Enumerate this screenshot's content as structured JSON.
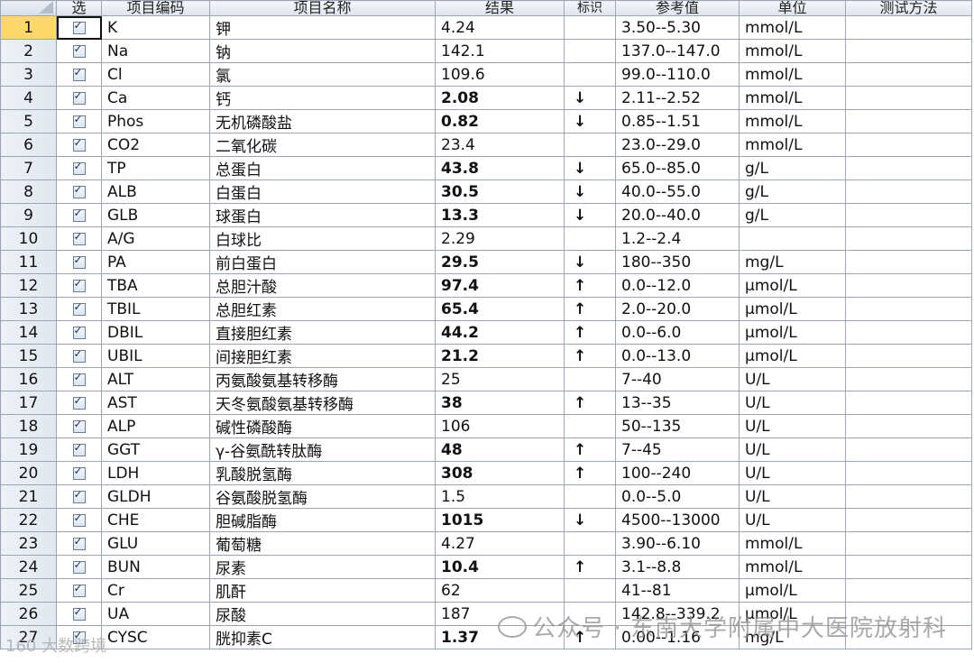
{
  "columns": {
    "select": "选",
    "code": "项目编码",
    "name": "项目名称",
    "result": "结果",
    "flag": "标识",
    "ref": "参考值",
    "unit": "单位",
    "method": "测试方法"
  },
  "selected_row": 1,
  "rows": [
    {
      "n": "1",
      "code": "K",
      "name": "钾",
      "result": "4.24",
      "flag": "",
      "dir": "",
      "ref": "3.50--5.30",
      "unit": "mmol/L",
      "method": ""
    },
    {
      "n": "2",
      "code": "Na",
      "name": "钠",
      "result": "142.1",
      "flag": "",
      "dir": "",
      "ref": "137.0--147.0",
      "unit": "mmol/L",
      "method": ""
    },
    {
      "n": "3",
      "code": "Cl",
      "name": "氯",
      "result": "109.6",
      "flag": "",
      "dir": "",
      "ref": "99.0--110.0",
      "unit": "mmol/L",
      "method": ""
    },
    {
      "n": "4",
      "code": "Ca",
      "name": "钙",
      "result": "2.08",
      "flag": "↓",
      "dir": "low",
      "ref": "2.11--2.52",
      "unit": "mmol/L",
      "method": ""
    },
    {
      "n": "5",
      "code": "Phos",
      "name": "无机磷酸盐",
      "result": "0.82",
      "flag": "↓",
      "dir": "low",
      "ref": "0.85--1.51",
      "unit": "mmol/L",
      "method": ""
    },
    {
      "n": "6",
      "code": "CO2",
      "name": "二氧化碳",
      "result": "23.4",
      "flag": "",
      "dir": "",
      "ref": "23.0--29.0",
      "unit": "mmol/L",
      "method": ""
    },
    {
      "n": "7",
      "code": "TP",
      "name": "总蛋白",
      "result": "43.8",
      "flag": "↓",
      "dir": "low",
      "ref": "65.0--85.0",
      "unit": "g/L",
      "method": ""
    },
    {
      "n": "8",
      "code": "ALB",
      "name": "白蛋白",
      "result": "30.5",
      "flag": "↓",
      "dir": "low",
      "ref": "40.0--55.0",
      "unit": "g/L",
      "method": ""
    },
    {
      "n": "9",
      "code": "GLB",
      "name": "球蛋白",
      "result": "13.3",
      "flag": "↓",
      "dir": "low",
      "ref": "20.0--40.0",
      "unit": "g/L",
      "method": ""
    },
    {
      "n": "10",
      "code": "A/G",
      "name": "白球比",
      "result": "2.29",
      "flag": "",
      "dir": "",
      "ref": "1.2--2.4",
      "unit": "",
      "method": ""
    },
    {
      "n": "11",
      "code": "PA",
      "name": "前白蛋白",
      "result": "29.5",
      "flag": "↓",
      "dir": "low",
      "ref": "180--350",
      "unit": "mg/L",
      "method": ""
    },
    {
      "n": "12",
      "code": "TBA",
      "name": "总胆汁酸",
      "result": "97.4",
      "flag": "↑",
      "dir": "high",
      "ref": "0.0--12.0",
      "unit": "μmol/L",
      "method": ""
    },
    {
      "n": "13",
      "code": "TBIL",
      "name": "总胆红素",
      "result": "65.4",
      "flag": "↑",
      "dir": "high",
      "ref": "2.0--20.0",
      "unit": "μmol/L",
      "method": ""
    },
    {
      "n": "14",
      "code": "DBIL",
      "name": "直接胆红素",
      "result": "44.2",
      "flag": "↑",
      "dir": "high",
      "ref": "0.0--6.0",
      "unit": "μmol/L",
      "method": ""
    },
    {
      "n": "15",
      "code": "UBIL",
      "name": "间接胆红素",
      "result": "21.2",
      "flag": "↑",
      "dir": "high",
      "ref": "0.0--13.0",
      "unit": "μmol/L",
      "method": ""
    },
    {
      "n": "16",
      "code": "ALT",
      "name": "丙氨酸氨基转移酶",
      "result": "25",
      "flag": "",
      "dir": "",
      "ref": "7--40",
      "unit": "U/L",
      "method": ""
    },
    {
      "n": "17",
      "code": "AST",
      "name": "天冬氨酸氨基转移酶",
      "result": "38",
      "flag": "↑",
      "dir": "high",
      "ref": "13--35",
      "unit": "U/L",
      "method": ""
    },
    {
      "n": "18",
      "code": "ALP",
      "name": "碱性磷酸酶",
      "result": "106",
      "flag": "",
      "dir": "",
      "ref": "50--135",
      "unit": "U/L",
      "method": ""
    },
    {
      "n": "19",
      "code": "GGT",
      "name": "γ-谷氨酰转肽酶",
      "result": "48",
      "flag": "↑",
      "dir": "high",
      "ref": "7--45",
      "unit": "U/L",
      "method": ""
    },
    {
      "n": "20",
      "code": "LDH",
      "name": "乳酸脱氢酶",
      "result": "308",
      "flag": "↑",
      "dir": "high",
      "ref": "100--240",
      "unit": "U/L",
      "method": ""
    },
    {
      "n": "21",
      "code": "GLDH",
      "name": "谷氨酸脱氢酶",
      "result": "1.5",
      "flag": "",
      "dir": "",
      "ref": "0.0--5.0",
      "unit": "U/L",
      "method": ""
    },
    {
      "n": "22",
      "code": "CHE",
      "name": "胆碱脂酶",
      "result": "1015",
      "flag": "↓",
      "dir": "low",
      "ref": "4500--13000",
      "unit": "U/L",
      "method": ""
    },
    {
      "n": "23",
      "code": "GLU",
      "name": "葡萄糖",
      "result": "4.27",
      "flag": "",
      "dir": "",
      "ref": "3.90--6.10",
      "unit": "mmol/L",
      "method": ""
    },
    {
      "n": "24",
      "code": "BUN",
      "name": "尿素",
      "result": "10.4",
      "flag": "↑",
      "dir": "high",
      "ref": "3.1--8.8",
      "unit": "mmol/L",
      "method": ""
    },
    {
      "n": "25",
      "code": "Cr",
      "name": "肌酐",
      "result": "62",
      "flag": "",
      "dir": "",
      "ref": "41--81",
      "unit": "μmol/L",
      "method": ""
    },
    {
      "n": "26",
      "code": "UA",
      "name": "尿酸",
      "result": "187",
      "flag": "",
      "dir": "",
      "ref": "142.8--339.2",
      "unit": "μmol/L",
      "method": ""
    },
    {
      "n": "27",
      "code": "CYSC",
      "name": "胱抑素C",
      "result": "1.37",
      "flag": "↑",
      "dir": "high",
      "ref": "0.00--1.16",
      "unit": "mg/L",
      "method": ""
    }
  ],
  "watermark": "公众号 · 东南大学附属中大医院放射科",
  "watermark2": "160 大数跨境"
}
